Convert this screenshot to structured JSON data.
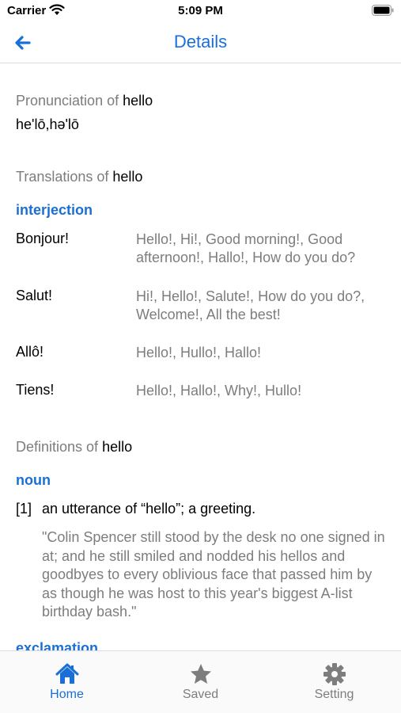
{
  "status_bar": {
    "carrier": "Carrier",
    "time": "5:09 PM"
  },
  "nav": {
    "title": "Details"
  },
  "pronunciation": {
    "label": "Pronunciation of",
    "word": "hello",
    "text": "he'lō,hə'lō"
  },
  "translations": {
    "label": "Translations of",
    "word": "hello",
    "part_of_speech": "interjection",
    "rows": [
      {
        "word": "Bonjour!",
        "meanings": "Hello!, Hi!, Good morning!, Good afternoon!, Hallo!, How do you do?"
      },
      {
        "word": "Salut!",
        "meanings": "Hi!, Hello!, Salute!, How do you do?, Welcome!, All the best!"
      },
      {
        "word": "Allô!",
        "meanings": "Hello!, Hullo!, Hallo!"
      },
      {
        "word": "Tiens!",
        "meanings": "Hello!, Hallo!, Why!, Hullo!"
      }
    ]
  },
  "definitions": {
    "label": "Definitions of",
    "word": "hello",
    "groups": [
      {
        "part_of_speech": "noun",
        "items": [
          {
            "number": "[1]",
            "text": "an utterance of “hello”; a greeting.",
            "example": "\"Colin Spencer still stood by the desk no one signed in at; and he still smiled and nodded his hellos and goodbyes to every oblivious face that passed him by as though he was host to this year's biggest A-list birthday bash.\""
          }
        ]
      },
      {
        "part_of_speech": "exclamation"
      }
    ]
  },
  "tabs": [
    {
      "label": "Home",
      "icon": "home-icon",
      "active": true
    },
    {
      "label": "Saved",
      "icon": "star-icon",
      "active": false
    },
    {
      "label": "Setting",
      "icon": "gear-icon",
      "active": false
    }
  ],
  "colors": {
    "accent": "#1a6fd6",
    "inactive": "#7d7d7d",
    "muted_text": "#7d7d7d"
  }
}
